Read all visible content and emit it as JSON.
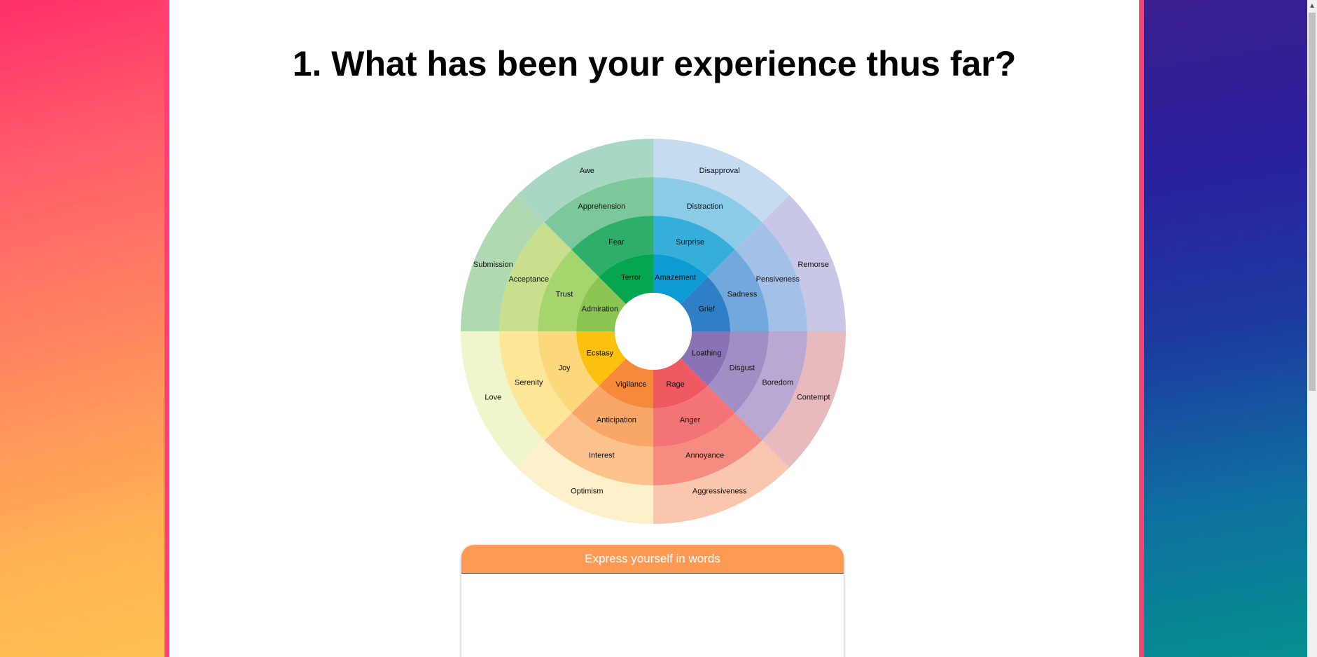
{
  "page": {
    "title": "1. What has been your experience thus far?"
  },
  "wheel": {
    "order_description": "Petals listed clockwise from top",
    "petals": [
      {
        "outer": "Disapproval",
        "mid": "Distraction",
        "core": "Surprise",
        "inner": "Amazement",
        "colors": [
          "#0d9bd3",
          "#35afd9",
          "#8ccbe6",
          "#c5dbf0"
        ]
      },
      {
        "outer": "Remorse",
        "mid": "Pensiveness",
        "core": "Sadness",
        "inner": "Grief",
        "colors": [
          "#2f7fc7",
          "#72a8db",
          "#a3c0e6",
          "#c8c8e6"
        ]
      },
      {
        "outer": "Contempt",
        "mid": "Boredom",
        "core": "Disgust",
        "inner": "Loathing",
        "colors": [
          "#8a72b6",
          "#a18ec5",
          "#b9a8d4",
          "#e8b9bd"
        ]
      },
      {
        "outer": "Aggressiveness",
        "mid": "Annoyance",
        "core": "Anger",
        "inner": "Rage",
        "colors": [
          "#ef5a61",
          "#f37474",
          "#f68c7f",
          "#fbc6ae"
        ]
      },
      {
        "outer": "Optimism",
        "mid": "Interest",
        "core": "Anticipation",
        "inner": "Vigilance",
        "colors": [
          "#f58a3a",
          "#f8a769",
          "#fcc28d",
          "#fff0cc"
        ]
      },
      {
        "outer": "Love",
        "mid": "Serenity",
        "core": "Joy",
        "inner": "Ecstasy",
        "colors": [
          "#fcc10e",
          "#fdd77c",
          "#fde698",
          "#f1f5cc"
        ]
      },
      {
        "outer": "Submission",
        "mid": "Acceptance",
        "core": "Trust",
        "inner": "Admiration",
        "colors": [
          "#8bc653",
          "#a6d46d",
          "#c8e08d",
          "#b0d8b1"
        ]
      },
      {
        "outer": "Awe",
        "mid": "Apprehension",
        "core": "Fear",
        "inner": "Terror",
        "colors": [
          "#04a651",
          "#2daf6a",
          "#7cc89a",
          "#a8d8c4"
        ]
      }
    ]
  },
  "card": {
    "header": "Express yourself in words",
    "placeholder": "",
    "value": ""
  },
  "colors": {
    "accent_pink": "#ff3e76",
    "card_header": "#ff9a55"
  }
}
